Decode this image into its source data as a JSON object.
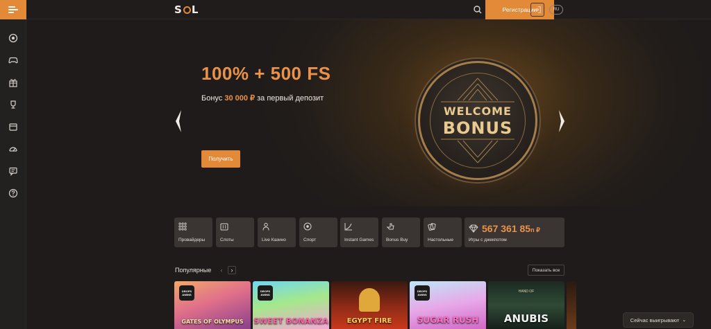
{
  "header": {
    "logo": "SOL",
    "register_label": "Регистрации",
    "lang_label": "RU",
    "colors": {
      "accent": "#e38a39"
    }
  },
  "sidebar": {
    "items": [
      {
        "icon": "soccer-ball-icon"
      },
      {
        "icon": "gamepad-icon"
      },
      {
        "icon": "gift-icon"
      },
      {
        "icon": "trophy-icon"
      },
      {
        "icon": "calendar-icon"
      },
      {
        "icon": "speedometer-icon"
      },
      {
        "icon": "chat-icon"
      },
      {
        "icon": "help-icon"
      }
    ]
  },
  "hero": {
    "title": "100% + 500 FS",
    "subtitle_prefix": "Бонус ",
    "subtitle_amount": "30 000 ₽",
    "subtitle_suffix": " за первый депозит",
    "cta_label": "Получить",
    "badge_line1": "WELCOME",
    "badge_line2": "BONUS"
  },
  "categories": [
    {
      "label": "Провайдеры",
      "icon": "grid-icon"
    },
    {
      "label": "Слоты",
      "icon": "slot-machine-icon"
    },
    {
      "label": "Live Казино",
      "icon": "dealer-icon"
    },
    {
      "label": "Спорт",
      "icon": "soccer-ball-icon"
    },
    {
      "label": "Instant Games",
      "icon": "chart-line-icon"
    },
    {
      "label": "Bonus Buy",
      "icon": "hand-icon"
    },
    {
      "label": "Настольные",
      "icon": "cards-icon"
    }
  ],
  "jackpot": {
    "value": "567 361 85",
    "value_tail": "n ₽",
    "label": "Игры с джекпотом",
    "icon": "diamond-icon"
  },
  "popular": {
    "title": "Популярные",
    "show_all_label": "Показать все",
    "games": [
      {
        "name": "GATES OF OLYMPUS",
        "badge": [
          "DROPS",
          "&WINS"
        ]
      },
      {
        "name": "SWEET BONANZA",
        "badge": [
          "DROPS",
          "&WINS"
        ]
      },
      {
        "name": "EGYPT FIRE",
        "badge": []
      },
      {
        "name": "SUGAR RUSH",
        "badge": [
          "DROPS",
          "&WINS"
        ]
      },
      {
        "name": "ANUBIS",
        "subtitle": "HAND OF",
        "badge": []
      }
    ]
  },
  "winning_now_label": "Сейчас выигрывают"
}
